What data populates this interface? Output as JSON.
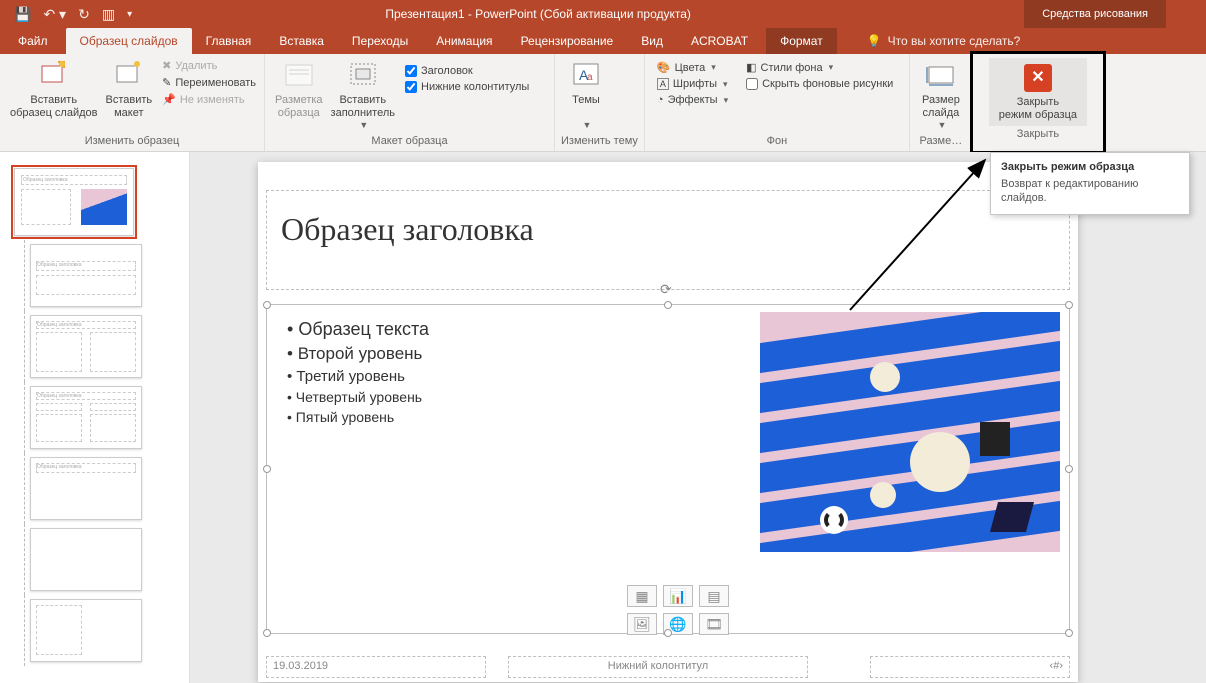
{
  "titlebar": {
    "title": "Презентация1 - PowerPoint (Сбой активации продукта)",
    "contextual": "Средства рисования"
  },
  "tabs": {
    "file": "Файл",
    "slide_master": "Образец слайдов",
    "home": "Главная",
    "insert": "Вставка",
    "transitions": "Переходы",
    "animations": "Анимация",
    "review": "Рецензирование",
    "view": "Вид",
    "acrobat": "ACROBAT",
    "format": "Формат",
    "tell_me": "Что вы хотите сделать?"
  },
  "ribbon": {
    "edit_master": {
      "insert_slide_master": "Вставить\nобразец слайдов",
      "insert_layout": "Вставить\nмакет",
      "delete": "Удалить",
      "rename": "Переименовать",
      "preserve": "Не изменять",
      "group_label": "Изменить образец"
    },
    "master_layout": {
      "master_layout": "Разметка\nобразца",
      "insert_placeholder": "Вставить\nзаполнитель",
      "title_chk": "Заголовок",
      "footers_chk": "Нижние колонтитулы",
      "group_label": "Макет образца"
    },
    "edit_theme": {
      "themes": "Темы",
      "group_label": "Изменить тему"
    },
    "background": {
      "colors": "Цвета",
      "fonts": "Шрифты",
      "effects": "Эффекты",
      "bg_styles": "Стили фона",
      "hide_bg": "Скрыть фоновые рисунки",
      "group_label": "Фон"
    },
    "size": {
      "slide_size": "Размер\nслайда",
      "group_label": "Разме…"
    },
    "close": {
      "close_master": "Закрыть\nрежим образца",
      "group_label": "Закрыть"
    }
  },
  "tooltip": {
    "title": "Закрыть режим образца",
    "body": "Возврат к редактированию слайдов."
  },
  "slide": {
    "title_placeholder": "Образец заголовка",
    "content_l1": "Образец текста",
    "content_l2": "Второй уровень",
    "content_l3": "Третий уровень",
    "content_l4": "Четвертый уровень",
    "content_l5": "Пятый уровень",
    "date": "19.03.2019",
    "footer": "Нижний колонтитул",
    "slide_number": "‹#›"
  },
  "thumbs": {
    "mini_title": "Образец заголовка"
  }
}
